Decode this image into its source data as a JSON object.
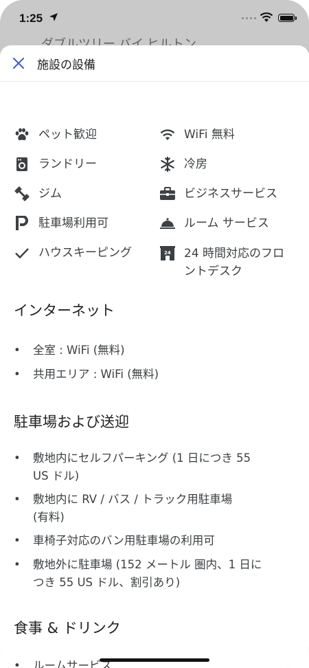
{
  "status_bar": {
    "time": "1:25"
  },
  "background": {
    "hotel_name": "ダブルツリー バイ ヒルトン"
  },
  "sheet": {
    "title": "施設の設備",
    "amenities": [
      {
        "icon": "paw-icon",
        "label": "ペット歓迎"
      },
      {
        "icon": "wifi-icon",
        "label": "WiFi 無料"
      },
      {
        "icon": "laundry-icon",
        "label": "ランドリー"
      },
      {
        "icon": "snowflake-icon",
        "label": "冷房"
      },
      {
        "icon": "dumbbell-icon",
        "label": "ジム"
      },
      {
        "icon": "briefcase-icon",
        "label": "ビジネスサービス"
      },
      {
        "icon": "parking-icon",
        "label": "駐車場利用可"
      },
      {
        "icon": "room-service-icon",
        "label": "ルーム サービス"
      },
      {
        "icon": "checkmark-icon",
        "label": "ハウスキーピング"
      },
      {
        "icon": "front-desk-24h-icon",
        "label_line1": "24 時間対応のフロ",
        "label_line2": "ントデスク"
      }
    ],
    "sections": [
      {
        "heading": "インターネット",
        "items": [
          "全室 : WiFi (無料)",
          "共用エリア : WiFi (無料)"
        ]
      },
      {
        "heading": "駐車場および送迎",
        "items": [
          [
            "敷地内にセルフパーキング (1 日につき 55",
            "US ドル)"
          ],
          [
            "敷地内に RV / バス / トラック用駐車場",
            "(有料)"
          ],
          [
            "車椅子対応のバン用駐車場の利用可"
          ],
          [
            "敷地外に駐車場 (152 メートル 圏内、1 日に",
            "つき 55 US ドル、割引あり)"
          ]
        ]
      },
      {
        "heading": "食事 & ドリンク",
        "items": [
          "ルームサービス"
        ]
      }
    ]
  },
  "colors": {
    "accent": "#4a62c7",
    "text": "#3c4043",
    "heading": "#202124",
    "icon": "#3c4043"
  }
}
